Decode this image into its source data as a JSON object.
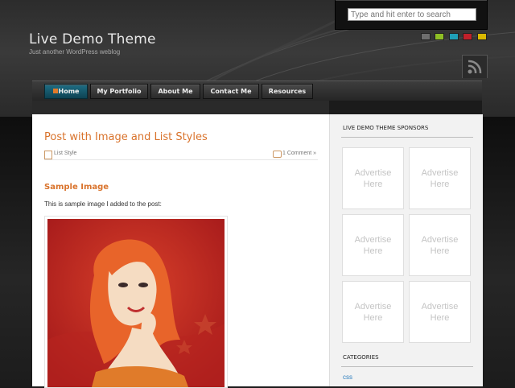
{
  "search": {
    "placeholder": "Type and hit enter to search"
  },
  "header": {
    "title": "Live Demo Theme",
    "tagline": "Just another WordPress weblog"
  },
  "color_swatches": [
    "#6e6e6e",
    "#8fbf25",
    "#1f9fb8",
    "#c0202a",
    "#d9b800"
  ],
  "nav": {
    "items": [
      {
        "label": "Home",
        "active": true
      },
      {
        "label": "My Portfolio",
        "active": false
      },
      {
        "label": "About Me",
        "active": false
      },
      {
        "label": "Contact Me",
        "active": false
      },
      {
        "label": "Resources",
        "active": false
      }
    ]
  },
  "post": {
    "title": "Post with Image and List Styles",
    "category": "List Style",
    "comments": "1 Comment »",
    "section_heading": "Sample Image",
    "body_text": "This is sample image I added to the post:"
  },
  "sidebar": {
    "sponsors_heading": "LIVE DEMO THEME SPONSORS",
    "ads": [
      {
        "line1": "Advertise",
        "line2": "Here"
      },
      {
        "line1": "Advertise",
        "line2": "Here"
      },
      {
        "line1": "Advertise",
        "line2": "Here"
      },
      {
        "line1": "Advertise",
        "line2": "Here"
      },
      {
        "line1": "Advertise",
        "line2": "Here"
      },
      {
        "line1": "Advertise",
        "line2": "Here"
      }
    ],
    "categories_heading": "CATEGORIES",
    "categories": [
      "css"
    ]
  },
  "colors": {
    "accent": "#d9732c",
    "link": "#2f7fbf",
    "nav_active": "#1f6f86"
  }
}
